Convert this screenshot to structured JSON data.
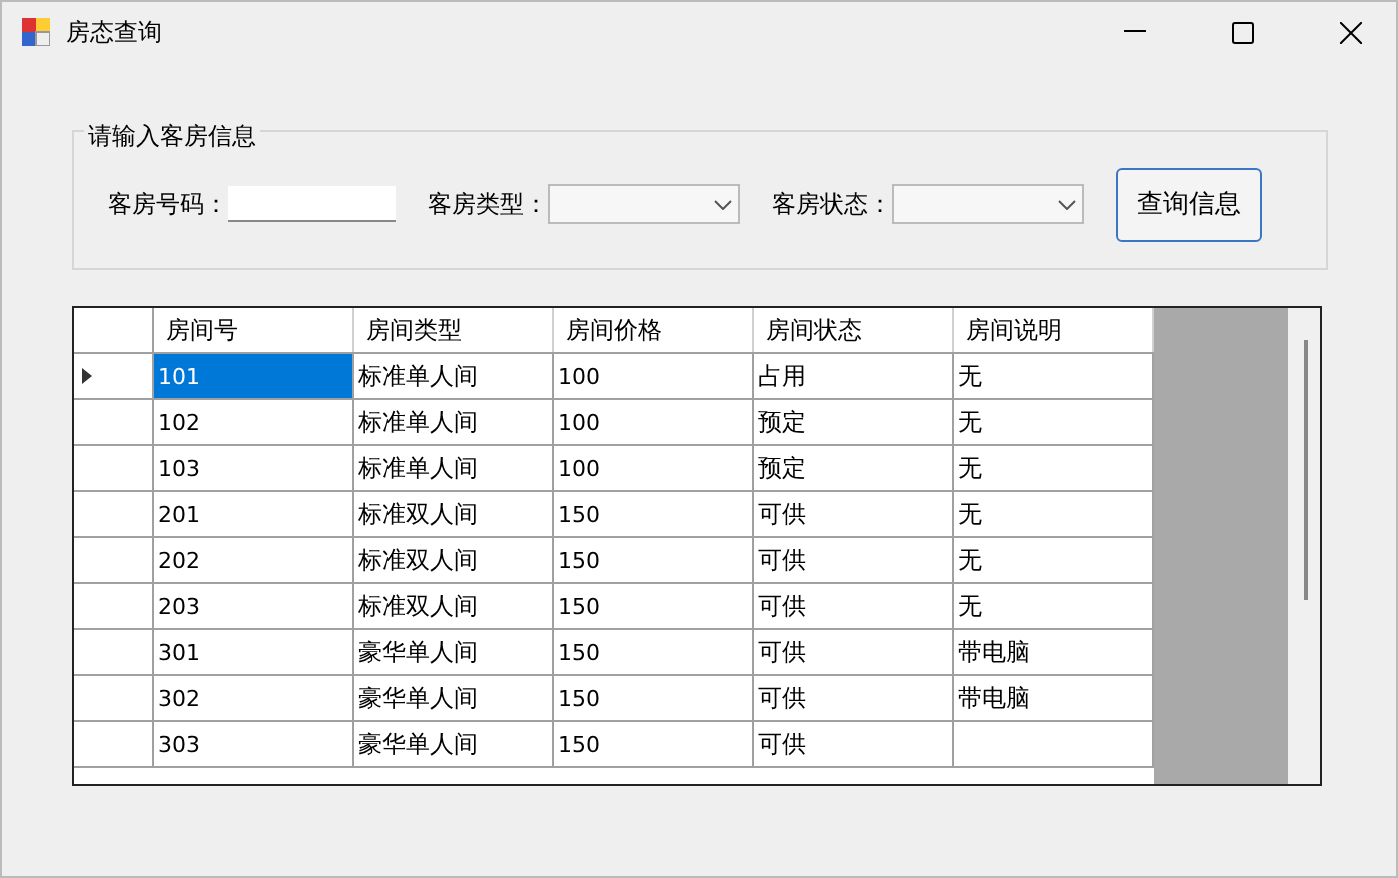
{
  "window": {
    "title": "房态查询"
  },
  "search_group": {
    "title": "请输入客房信息",
    "fields": [
      {
        "kind": "text",
        "label": "客房号码："
      },
      {
        "kind": "combo",
        "label": "客房类型："
      },
      {
        "kind": "combo",
        "label": "客房状态："
      }
    ],
    "button": "查询信息"
  },
  "table": {
    "columns": [
      "房间号",
      "房间类型",
      "房间价格",
      "房间状态",
      "房间说明"
    ],
    "rows": [
      {
        "selected": true,
        "cells": [
          "101",
          "标准单人间",
          "100",
          "占用",
          "无"
        ]
      },
      {
        "selected": false,
        "cells": [
          "102",
          "标准单人间",
          "100",
          "预定",
          "无"
        ]
      },
      {
        "selected": false,
        "cells": [
          "103",
          "标准单人间",
          "100",
          "预定",
          "无"
        ]
      },
      {
        "selected": false,
        "cells": [
          "201",
          "标准双人间",
          "150",
          "可供",
          "无"
        ]
      },
      {
        "selected": false,
        "cells": [
          "202",
          "标准双人间",
          "150",
          "可供",
          "无"
        ]
      },
      {
        "selected": false,
        "cells": [
          "203",
          "标准双人间",
          "150",
          "可供",
          "无"
        ]
      },
      {
        "selected": false,
        "cells": [
          "301",
          "豪华单人间",
          "150",
          "可供",
          "带电脑"
        ]
      },
      {
        "selected": false,
        "cells": [
          "302",
          "豪华单人间",
          "150",
          "可供",
          "带电脑"
        ]
      },
      {
        "selected": false,
        "cells": [
          "303",
          "豪华单人间",
          "150",
          "可供",
          ""
        ]
      }
    ]
  }
}
